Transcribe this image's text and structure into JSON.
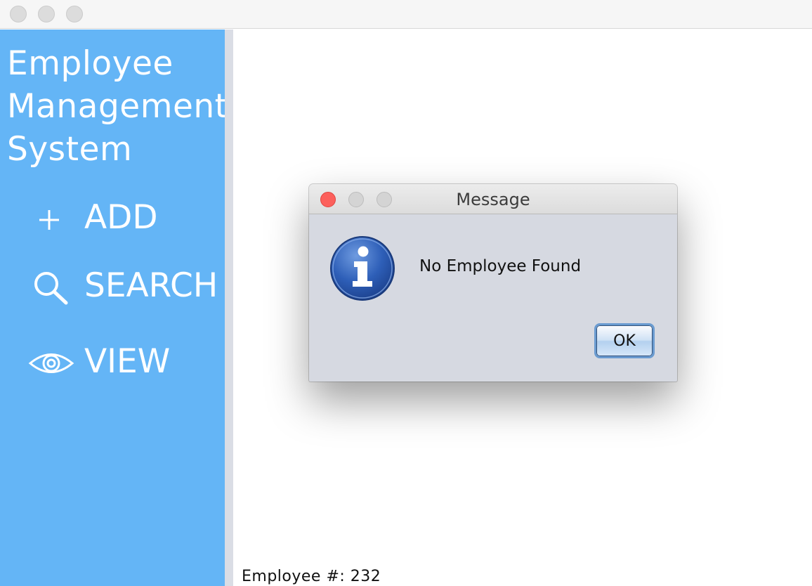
{
  "app": {
    "title_lines": [
      "Employee",
      "Management",
      "System"
    ]
  },
  "sidebar": {
    "items": [
      {
        "label": "ADD",
        "icon": "plus-icon"
      },
      {
        "label": "SEARCH",
        "icon": "search-icon"
      },
      {
        "label": "VIEW",
        "icon": "eye-icon"
      }
    ],
    "background": "#64b5f6"
  },
  "main": {
    "employee_label": "Employee #:",
    "employee_number": "232"
  },
  "dialog": {
    "title": "Message",
    "message": "No Employee Found",
    "ok_label": "OK",
    "icon": "info-icon"
  }
}
